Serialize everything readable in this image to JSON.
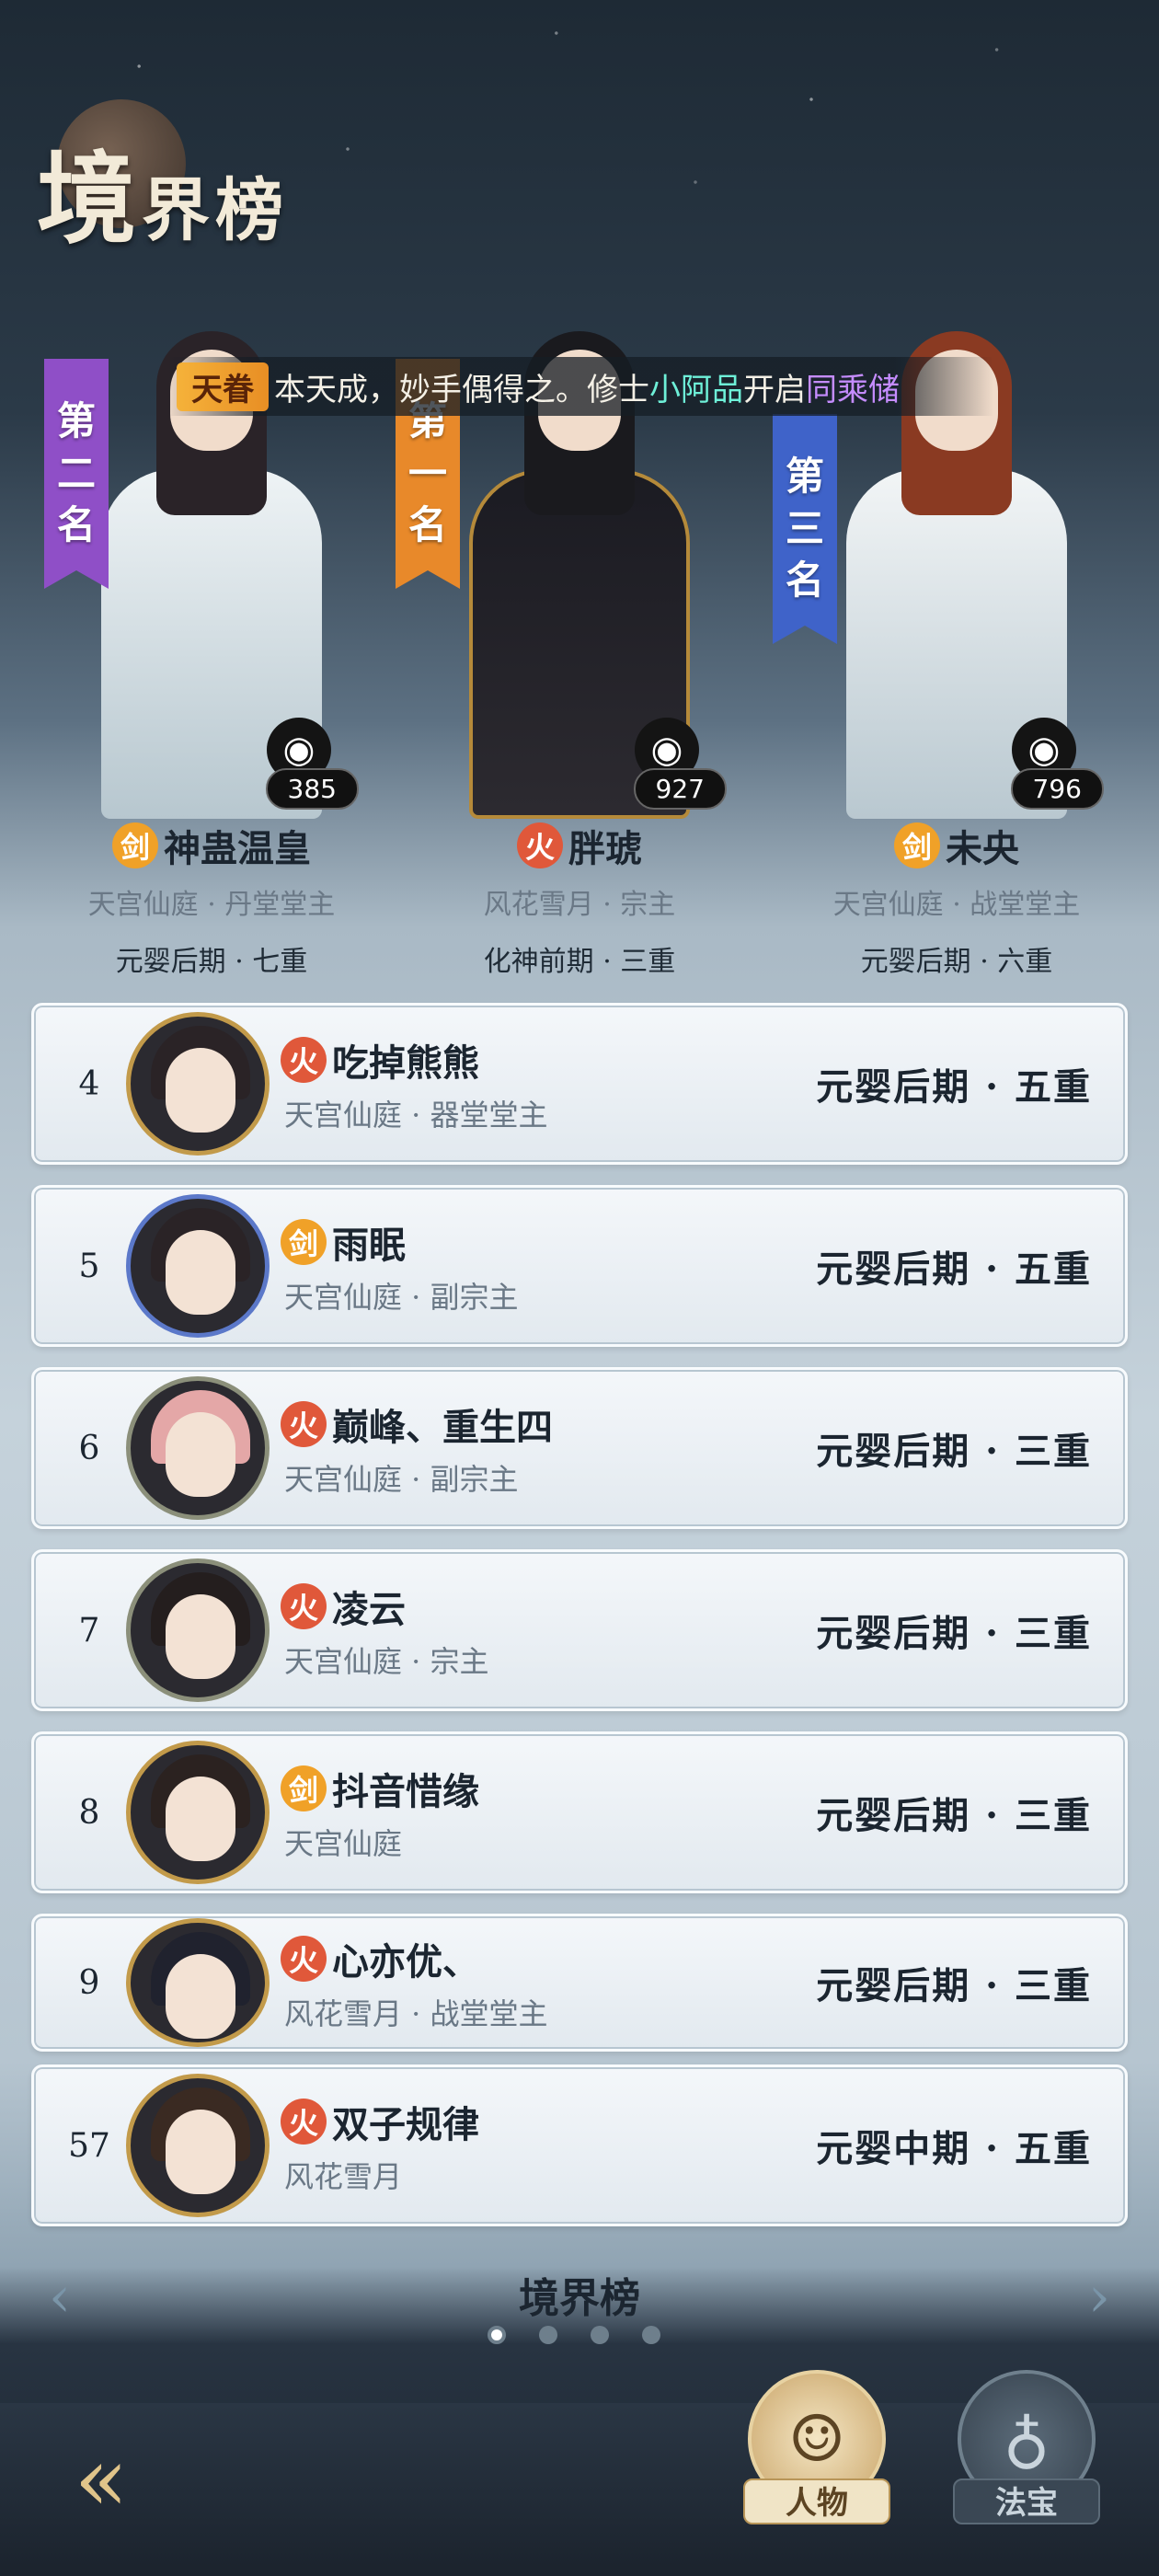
{
  "title": {
    "big": "境",
    "small": "界榜"
  },
  "marquee": {
    "tag": "天眷",
    "text1": "本天成，妙手偶得之。修士",
    "name1": "小阿品",
    "text2": "开启",
    "name2": "同乘储"
  },
  "colors": {
    "fire": "#e0583a",
    "sword": "#f0a128",
    "gold_frame": "#c29a4a"
  },
  "podium": [
    {
      "flag": [
        "第",
        "二",
        "名"
      ],
      "flag_color": "#8f4fc7",
      "score": "385",
      "element_icon": "sword",
      "element_char": "剑",
      "name": "神蛊温皇",
      "sect": "天宫仙庭 · 丹堂堂主",
      "realm": "元婴后期 · 七重"
    },
    {
      "flag": [
        "第",
        "一",
        "名"
      ],
      "flag_color": "#e8892a",
      "score": "927",
      "element_icon": "fire",
      "element_char": "火",
      "name": "胖琥",
      "sect": "风花雪月 · 宗主",
      "realm": "化神前期 · 三重"
    },
    {
      "flag": [
        "第",
        "三",
        "名"
      ],
      "flag_color": "#3f63c9",
      "score": "796",
      "element_icon": "sword",
      "element_char": "剑",
      "name": "未央",
      "sect": "天宫仙庭 · 战堂堂主",
      "realm": "元婴后期 · 六重"
    }
  ],
  "rows": [
    {
      "rank": "4",
      "element_icon": "fire",
      "element_char": "火",
      "name": "吃掉熊熊",
      "sect": "天宫仙庭 · 器堂堂主",
      "realm": "元婴后期 · 五重"
    },
    {
      "rank": "5",
      "element_icon": "sword",
      "element_char": "剑",
      "name": "雨眠",
      "sect": "天宫仙庭 · 副宗主",
      "realm": "元婴后期 · 五重"
    },
    {
      "rank": "6",
      "element_icon": "fire",
      "element_char": "火",
      "name": "巅峰、重生四",
      "sect": "天宫仙庭 · 副宗主",
      "realm": "元婴后期 · 三重"
    },
    {
      "rank": "7",
      "element_icon": "fire",
      "element_char": "火",
      "name": "凌云",
      "sect": "天宫仙庭 · 宗主",
      "realm": "元婴后期 · 三重"
    },
    {
      "rank": "8",
      "element_icon": "sword",
      "element_char": "剑",
      "name": "抖音惜缘",
      "sect": "天宫仙庭",
      "realm": "元婴后期 · 三重"
    },
    {
      "rank": "9",
      "element_icon": "fire",
      "element_char": "火",
      "name": "心亦优、",
      "sect": "风花雪月 · 战堂堂主",
      "realm": "元婴后期 · 三重"
    }
  ],
  "self_row": {
    "rank": "57",
    "element_icon": "fire",
    "element_char": "火",
    "name": "双子规律",
    "sect": "风花雪月",
    "realm": "元婴中期 · 五重"
  },
  "pager": {
    "title": "境界榜",
    "arrow_left": "‹",
    "arrow_right": "›",
    "page_count": 4,
    "active_page": 1
  },
  "bottom": {
    "back_icon": "back-arrow-icon",
    "tabs": [
      {
        "label": "人物",
        "icon": "person-icon"
      },
      {
        "label": "法宝",
        "icon": "treasure-gourd-icon"
      }
    ]
  }
}
